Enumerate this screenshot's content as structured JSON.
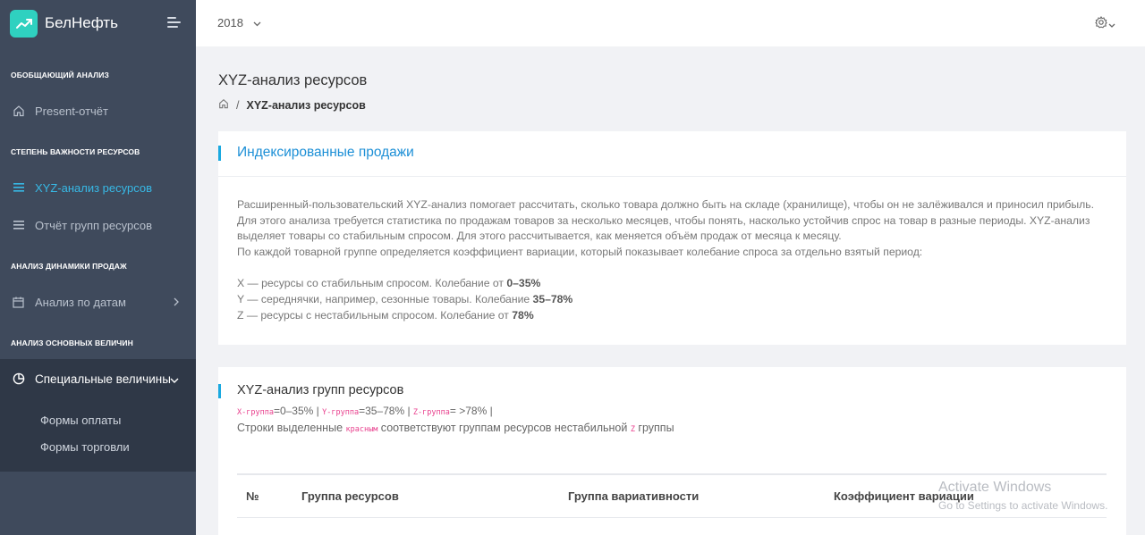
{
  "brand": {
    "name": "БелНефть",
    "accent": "#2fd1c0"
  },
  "sidebar": {
    "sections": [
      "Обобщающий анализ",
      "Степень важности ресурсов",
      "Анализ динамики продаж",
      "Анализ основных величин"
    ],
    "items": [
      {
        "label": "Present-отчёт",
        "icon": "home-icon"
      },
      {
        "label": "XYZ-анализ ресурсов",
        "icon": "list-icon",
        "active": true
      },
      {
        "label": "Отчёт групп ресурсов",
        "icon": "list-icon"
      },
      {
        "label": "Анализ по датам",
        "icon": "calendar-icon"
      },
      {
        "label": "Специальные величины",
        "icon": "pie-chart-icon",
        "expanded": true
      }
    ],
    "subitems": [
      "Формы оплаты",
      "Формы торговли"
    ]
  },
  "topbar": {
    "year": "2018"
  },
  "page": {
    "title": "XYZ-анализ ресурсов",
    "breadcrumb_current": "XYZ-анализ ресурсов"
  },
  "card1": {
    "title": "Индексированные продажи",
    "desc_1": "Расширенный-пользовательский XYZ-анализ помогает рассчитать, сколько товара должно быть на складе (хранилище), чтобы он не залёживался и приносил прибыль. Для этого анализа требуется статистика по продажам товаров за несколько месяцев, чтобы понять, насколько устойчив спрос на товар в разные периоды. XYZ-анализ выделяет товары со стабильным спросом. Для этого рассчитывается, как меняется объём продаж от месяца к месяцу.",
    "desc_2": "По каждой товарной группе определяется коэффициент вариации, который показывает колебание спроса за отдельно взятый период:",
    "x_text": "X — ресурсы со стабильным спросом. Колебание от ",
    "x_val": "0–35%",
    "y_text": "Y — середнячки, например, сезонные товары. Колебание ",
    "y_val": "35–78%",
    "z_text": "Z — ресурсы с нестабильным спросом. Колебание от ",
    "z_val": "78%"
  },
  "card2": {
    "title": "XYZ-анализ групп ресурсов",
    "x_code": "X-группа",
    "x_range": "=0–35% | ",
    "y_code": "Y-группа",
    "y_range": "=35–78% | ",
    "z_code": "Z-группа",
    "z_range": "= >78% |",
    "note_1": "Строки выделенные ",
    "note_code": "красным",
    "note_2": " соответствуют группам ресурсов нестабильной ",
    "note_z": "Z",
    "note_3": " группы",
    "columns": [
      "№",
      "Группа ресурсов",
      "Группа вариативности",
      "Коэффициент вариации"
    ]
  },
  "watermark": {
    "line1": "Activate Windows",
    "line2": "Go to Settings to activate Windows."
  }
}
